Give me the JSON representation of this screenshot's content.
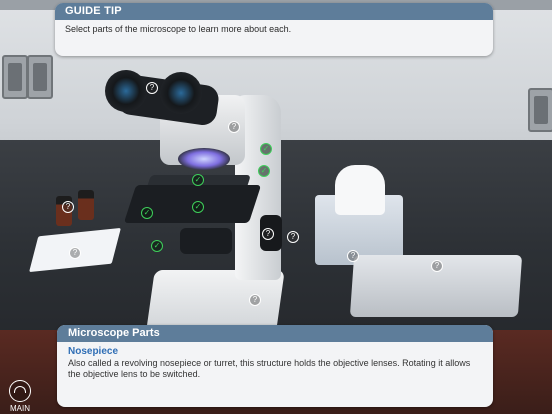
{
  "guide_tip": {
    "title": "GUIDE TIP",
    "text": "Select parts of the microscope to learn more about each."
  },
  "parts_panel": {
    "header": "Microscope Parts",
    "part_name": "Nosepiece",
    "description": "Also called a revolving nosepiece or turret, this structure holds the objective lenses. Rotating it allows the objective lens to be switched."
  },
  "main_button": {
    "label": "MAIN",
    "icon": "main-menu-icon"
  },
  "hotspot_glyphs": {
    "unvisited": "?",
    "visited": "✓"
  },
  "hotspots": [
    {
      "name": "hotspot-eyepiece",
      "state": "unvisited"
    },
    {
      "name": "hotspot-arm-upper",
      "state": "unvisited"
    },
    {
      "name": "hotspot-nosepiece",
      "state": "visited"
    },
    {
      "name": "hotspot-objective",
      "state": "visited"
    },
    {
      "name": "hotspot-stage",
      "state": "visited"
    },
    {
      "name": "hotspot-stage-clip",
      "state": "visited"
    },
    {
      "name": "hotspot-condenser",
      "state": "visited"
    },
    {
      "name": "hotspot-arm-label",
      "state": "visited"
    },
    {
      "name": "hotspot-fine-focus",
      "state": "unvisited"
    },
    {
      "name": "hotspot-coarse-focus",
      "state": "unvisited"
    },
    {
      "name": "hotspot-base",
      "state": "unvisited"
    },
    {
      "name": "hotspot-bottles",
      "state": "unvisited"
    },
    {
      "name": "hotspot-slide-box",
      "state": "unvisited"
    },
    {
      "name": "hotspot-tissue-box",
      "state": "unvisited"
    },
    {
      "name": "hotspot-tray",
      "state": "unvisited"
    }
  ],
  "colors": {
    "header_bar": "#5e7d9a",
    "part_title": "#2f6eb5",
    "visited_check": "#3ecf5a"
  }
}
